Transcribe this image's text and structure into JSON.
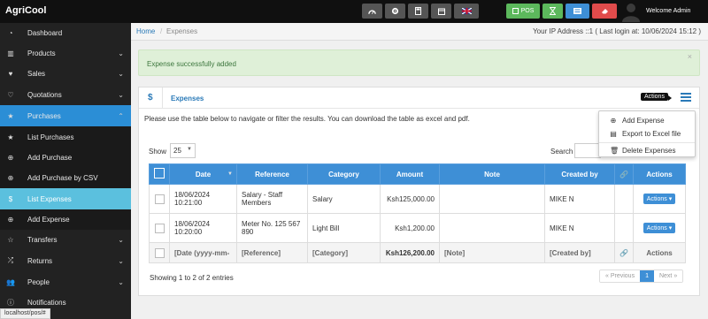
{
  "app": {
    "brand": "AgriCool",
    "welcome": "Welcome Admin"
  },
  "topbar": {
    "buttons": [
      {
        "icon": "dashboard-icon"
      },
      {
        "icon": "settings-icon"
      },
      {
        "icon": "calculator-icon"
      },
      {
        "icon": "calendar-icon"
      },
      {
        "icon": "flag-uk-icon"
      },
      {
        "icon": "pos-icon",
        "label": "POS"
      },
      {
        "icon": "hourglass-icon"
      },
      {
        "icon": "list-icon"
      },
      {
        "icon": "eraser-icon"
      }
    ]
  },
  "sidebar": {
    "items": [
      {
        "label": "Dashboard",
        "icon": "dashboard-icon"
      },
      {
        "label": "Products",
        "icon": "barcode-icon",
        "has_children": true
      },
      {
        "label": "Sales",
        "icon": "heart-icon",
        "has_children": true
      },
      {
        "label": "Quotations",
        "icon": "heart-outline-icon",
        "has_children": true
      },
      {
        "label": "Purchases",
        "icon": "star-icon",
        "has_children": true,
        "expanded": true
      },
      {
        "label": "List Purchases",
        "icon": "star-icon",
        "sub": true
      },
      {
        "label": "Add Purchase",
        "icon": "plus-circle-icon",
        "sub": true
      },
      {
        "label": "Add Purchase by CSV",
        "icon": "plus-circle-icon",
        "sub": true
      },
      {
        "label": "List Expenses",
        "icon": "dollar-icon",
        "sub": true,
        "current": true
      },
      {
        "label": "Add Expense",
        "icon": "plus-circle-icon",
        "sub": true
      },
      {
        "label": "Transfers",
        "icon": "star-outline-icon",
        "has_children": true
      },
      {
        "label": "Returns",
        "icon": "random-icon",
        "has_children": true
      },
      {
        "label": "People",
        "icon": "users-icon",
        "has_children": true
      },
      {
        "label": "Notifications",
        "icon": "info-icon"
      }
    ]
  },
  "statusbar": "localhost/pos/#",
  "breadcrumb": {
    "home": "Home",
    "sep": "/",
    "current": "Expenses"
  },
  "ip_info": "Your IP Address ::1 ( Last login at: 10/06/2024 15:12 )",
  "alert": {
    "text": "Expense successfully added",
    "close": "×"
  },
  "box": {
    "icon": "$",
    "title": "Expenses",
    "actions_tooltip": "Actions",
    "intro": "Please use the table below to navigate or filter the results. You can download the table as excel and pdf."
  },
  "actions_menu": [
    {
      "label": "Add Expense",
      "icon": "plus-circle-icon"
    },
    {
      "label": "Export to Excel file",
      "icon": "file-excel-icon"
    },
    {
      "label": "Delete Expenses",
      "icon": "trash-icon"
    }
  ],
  "table": {
    "show_label": "Show",
    "page_size": "25",
    "search_label": "Search",
    "columns": [
      "Date",
      "Reference",
      "Category",
      "Amount",
      "Note",
      "Created by",
      "",
      "Actions"
    ],
    "rows": [
      {
        "date_line1": "18/06/2024",
        "date_line2": "10:21:00",
        "reference": "Salary - Staff Members",
        "category": "Salary",
        "amount": "Ksh125,000.00",
        "note": "",
        "created_by": "MIKE N",
        "actions": "Actions"
      },
      {
        "date_line1": "18/06/2024",
        "date_line2": "10:20:00",
        "reference": "Meter No. 125 567 890",
        "category": "Light Bill",
        "amount": "Ksh1,200.00",
        "note": "",
        "created_by": "MIKE N",
        "actions": "Actions"
      }
    ],
    "footer": {
      "date": "[Date (yyyy-mm-",
      "reference": "[Reference]",
      "category": "[Category]",
      "amount": "Ksh126,200.00",
      "note": "[Note]",
      "created_by": "[Created by]",
      "actions": "Actions"
    },
    "entries_info": "Showing 1 to 2 of 2 entries",
    "pagination": {
      "prev": "« Previous",
      "page": "1",
      "next": "Next »"
    }
  },
  "colors": {
    "topbar": "#101010",
    "sidebar": "#222222",
    "active": "#2b8ed6",
    "current": "#5bc0de",
    "table_header": "#3e8fd6",
    "alert_bg": "#dff0d8"
  }
}
